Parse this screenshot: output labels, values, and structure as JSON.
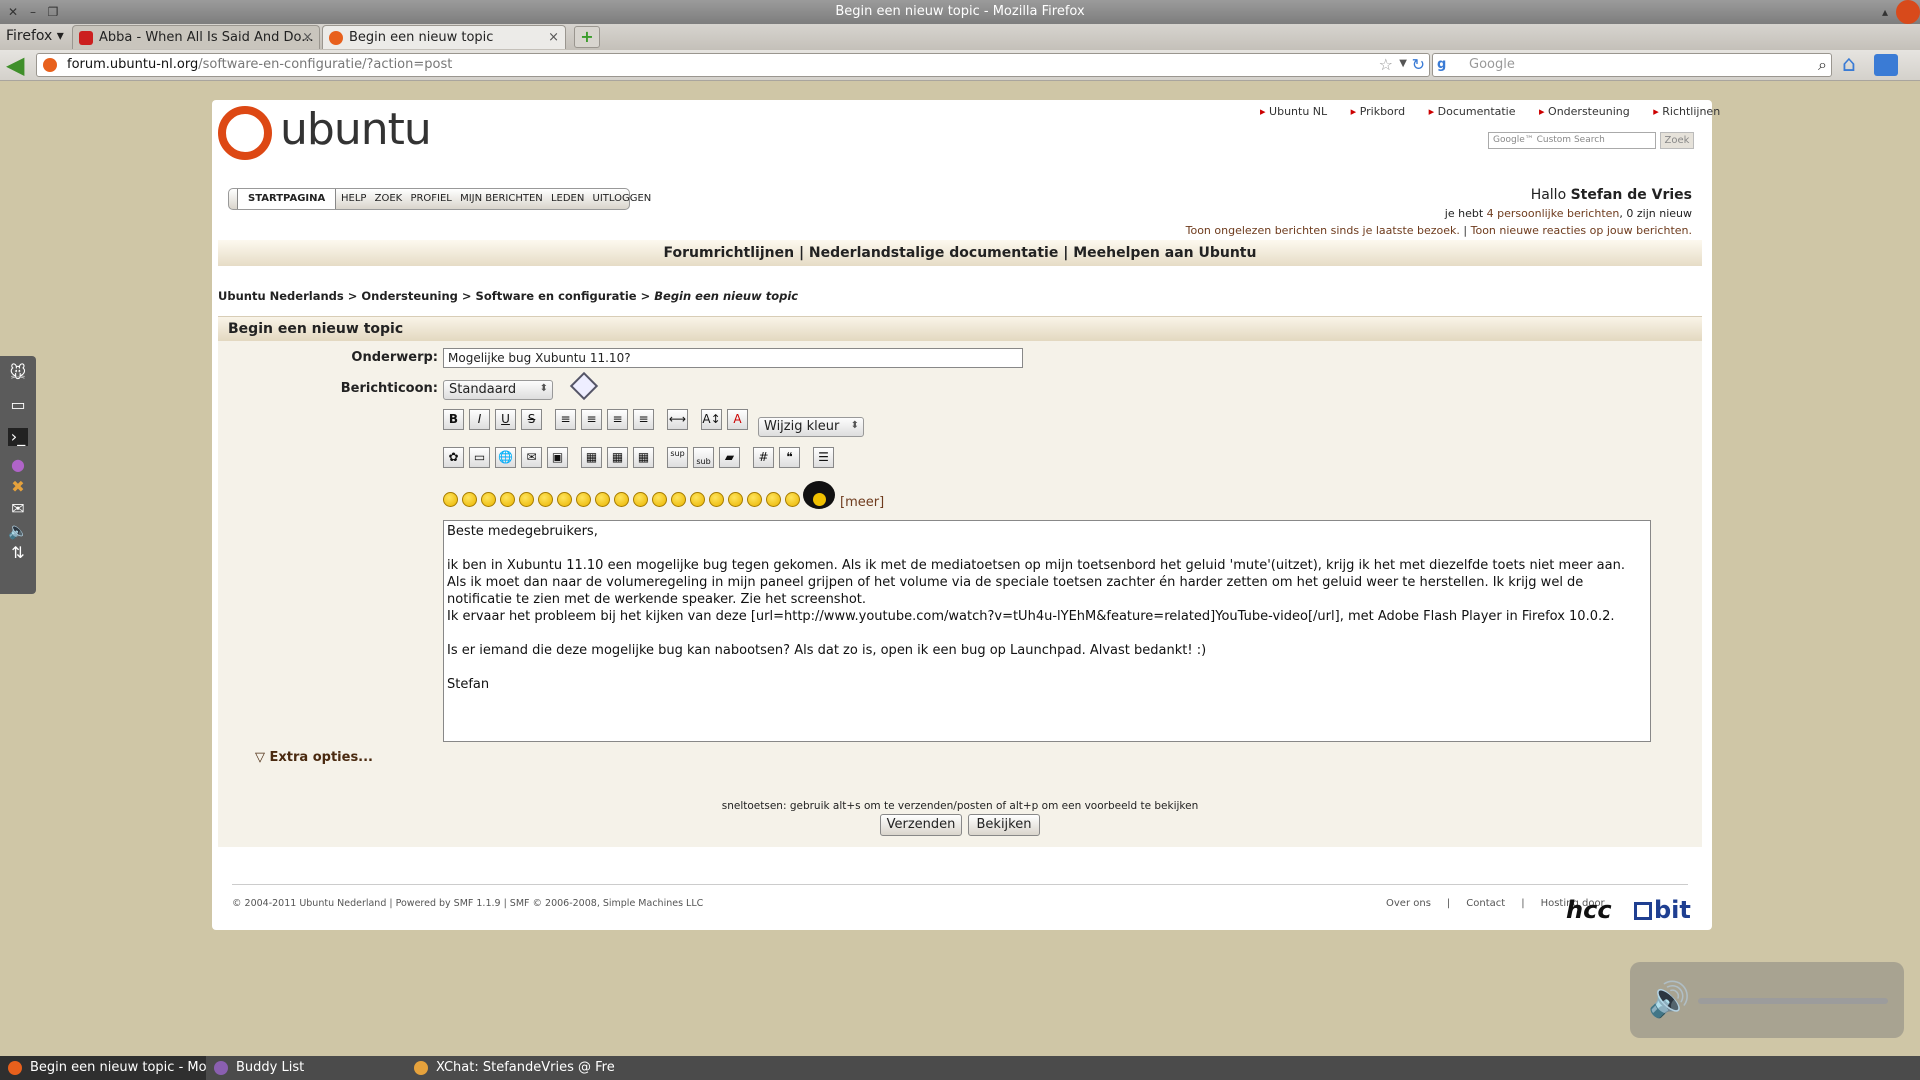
{
  "window": {
    "title": "Begin een nieuw topic - Mozilla Firefox"
  },
  "browser": {
    "menu_label": "Firefox",
    "tabs": [
      {
        "label": "Abba - When All Is Said And Do...",
        "close": "×"
      },
      {
        "label": "Begin een nieuw topic",
        "close": "×"
      }
    ],
    "new_tab": "+",
    "url_host": "forum.ubuntu-nl.org",
    "url_path": "/software-en-configuratie/?action=post",
    "search_engine": "g",
    "search_placeholder": "Google"
  },
  "site": {
    "logo_text": "ubuntu",
    "top_links": [
      "Ubuntu NL",
      "Prikbord",
      "Documentatie",
      "Ondersteuning",
      "Richtlijnen"
    ],
    "custom_search_placeholder": "Google™ Custom Search",
    "search_button": "Zoek",
    "menu": {
      "home": "STARTPAGINA",
      "items": [
        "HELP",
        "ZOEK",
        "PROFIEL",
        "MIJN BERICHTEN",
        "LEDEN",
        "UITLOGGEN"
      ]
    },
    "greeting_prefix": "Hallo ",
    "greeting_name": "Stefan de Vries",
    "pm_prefix": "je hebt ",
    "pm_link": "4 persoonlijke berichten",
    "pm_suffix": ", 0 zijn nieuw",
    "unread_link": "Toon ongelezen berichten sinds je laatste bezoek.",
    "sep": " | ",
    "replies_link": "Toon nieuwe reacties op jouw berichten.",
    "bigbar": "Forumrichtlijnen | Nederlandstalige documentatie | Meehelpen aan Ubuntu",
    "breadcrumb": {
      "path": "Ubuntu Nederlands > Ondersteuning > Software en configuratie > ",
      "current": "Begin een nieuw topic"
    },
    "section_title": "Begin een nieuw topic"
  },
  "form": {
    "subject_label": "Onderwerp:",
    "subject_value": "Mogelijke bug Xubuntu 11.10?",
    "icon_label": "Berichticoon:",
    "icon_value": "Standaard",
    "toolbar1": [
      "B",
      "I",
      "U",
      "S",
      "≡",
      "≡",
      "≡",
      "≡",
      "⟷",
      "A↕",
      "A"
    ],
    "toolbar2": [
      "✿",
      "▭",
      "🌐",
      "✉",
      "▣",
      "▦",
      "▦",
      "▦",
      "sup",
      "sub",
      "▰",
      "#",
      "❝",
      "☰"
    ],
    "color_select": "Wijzig kleur",
    "more_smileys": "[meer]",
    "message": "Beste medegebruikers,\n\nik ben in Xubuntu 11.10 een mogelijke bug tegen gekomen. Als ik met de mediatoetsen op mijn toetsenbord het geluid 'mute'(uitzet), krijg ik het met diezelfde toets niet meer aan. Als ik moet dan naar de volumeregeling in mijn paneel grijpen of het volume via de speciale toetsen zachter én harder zetten om het geluid weer te herstellen. Ik krijg wel de notificatie te zien met de werkende speaker. Zie het screenshot.\nIk ervaar het probleem bij het kijken van deze [url=http://www.youtube.com/watch?v=tUh4u-lYEhM&feature=related]YouTube-video[/url], met Adobe Flash Player in Firefox 10.0.2.\n\nIs er iemand die deze mogelijke bug kan nabootsen? Als dat zo is, open ik een bug op Launchpad. Alvast bedankt! :)\n\nStefan",
    "extra_options": "Extra opties...",
    "shortcut_hint": "sneltoetsen: gebruik alt+s om te verzenden/posten of alt+p om een voorbeeld te bekijken",
    "submit_button": "Verzenden",
    "preview_button": "Bekijken"
  },
  "footer": {
    "copyright": "© 2004-2011 Ubuntu Nederland | Powered by SMF 1.1.9 | SMF © 2006-2008, Simple Machines LLC",
    "links": [
      "Over ons",
      "Contact",
      "Hosting door"
    ],
    "sep": "|",
    "hcc": "hcc",
    "bit": "bit"
  },
  "volume_osd": {
    "level_fraction": 0.0
  },
  "taskbar": [
    {
      "label": "Begin een nieuw topic - Mo...",
      "icon_color": "#e8601c"
    },
    {
      "label": "Buddy List",
      "icon_color": "#8a5fb0"
    },
    {
      "label": "XChat: StefandeVries @ Fre...",
      "icon_color": "#e6a23c"
    }
  ],
  "colors": {
    "accent": "#dd4814",
    "link": "#6e3b1d"
  }
}
